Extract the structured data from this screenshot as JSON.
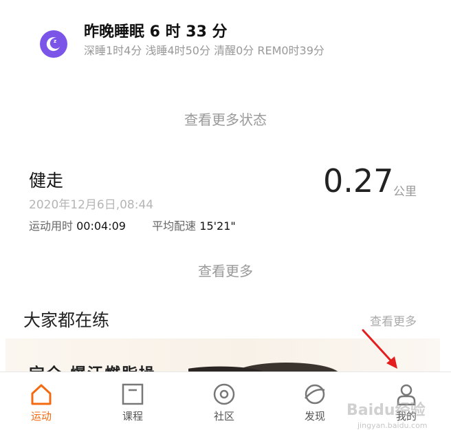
{
  "sleep": {
    "title": "昨晚睡眠 6 时 33 分",
    "detail": "深睡1时4分 浅睡4时50分 清醒0分 REM0时39分",
    "more_link": "查看更多状态",
    "badge_color": "#7b55e8"
  },
  "workout": {
    "type": "健走",
    "datetime": "2020年12月6日,08:44",
    "duration_label": "运动用时",
    "duration_value": "00:04:09",
    "pace_label": "平均配速",
    "pace_value": "15'21\"",
    "distance": "0.27",
    "distance_unit": "公里",
    "more_link": "查看更多"
  },
  "popular": {
    "title": "大家都在练",
    "more_link": "查看更多",
    "banner_title": "宝全 爆汗燃脂操"
  },
  "nav": {
    "accent_color": "#f36a10",
    "items": [
      {
        "label": "运动",
        "icon": "home-icon"
      },
      {
        "label": "课程",
        "icon": "course-icon"
      },
      {
        "label": "社区",
        "icon": "community-icon"
      },
      {
        "label": "发现",
        "icon": "discover-icon"
      },
      {
        "label": "我的",
        "icon": "profile-icon"
      }
    ]
  },
  "annotation": {
    "arrow_color": "#e41e1e"
  },
  "watermark": {
    "text": "Baidu经验",
    "url": "jingyan.baidu.com"
  }
}
